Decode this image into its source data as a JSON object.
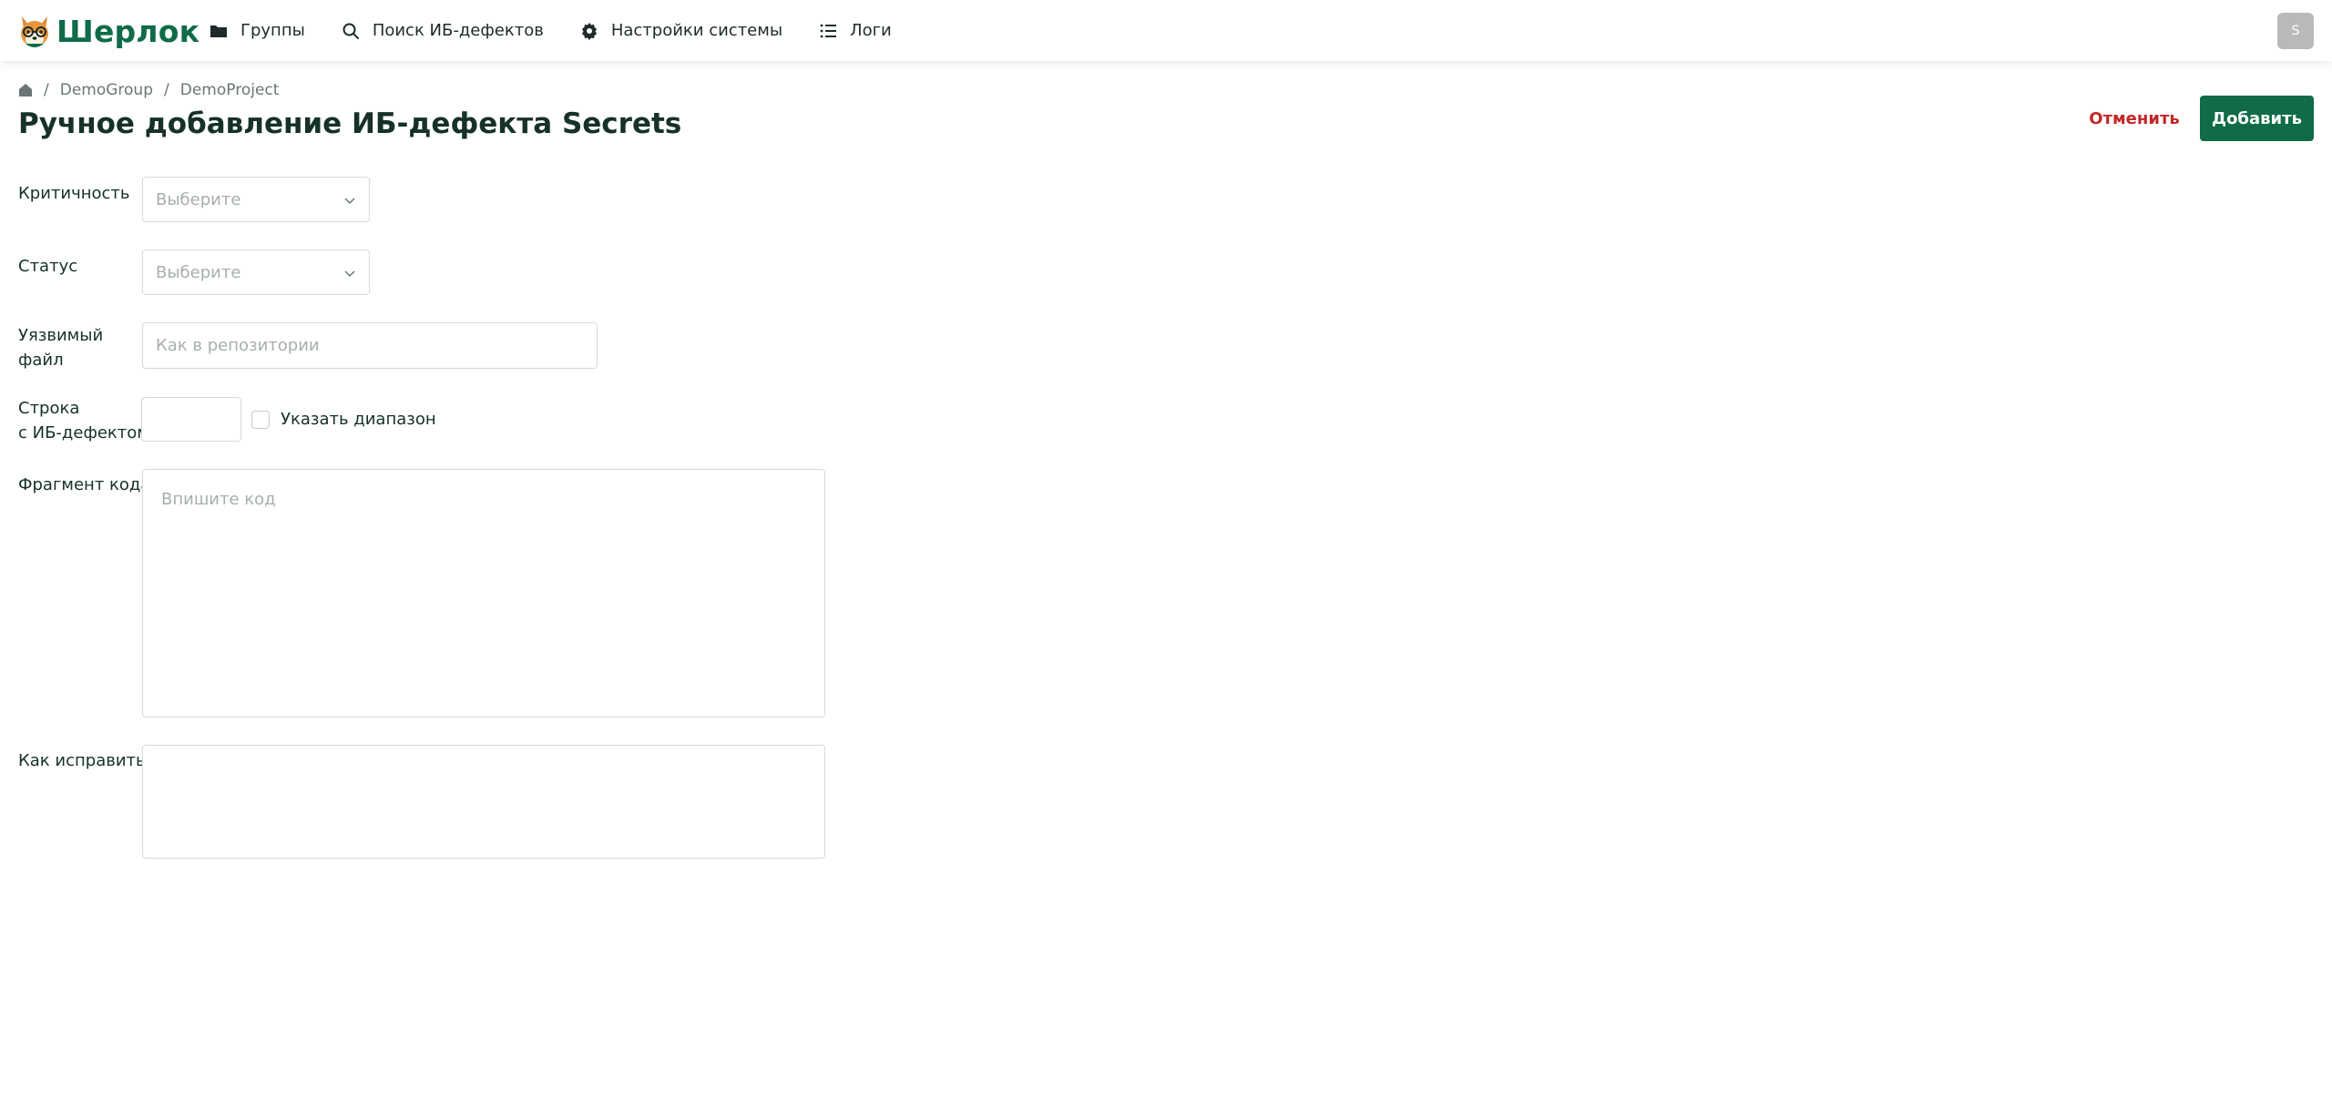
{
  "app": {
    "logo_text": "Шерлок",
    "brand_color": "#0f6b48",
    "danger_color": "#c32727"
  },
  "nav": {
    "items": [
      {
        "label": "Группы",
        "icon": "folder-icon"
      },
      {
        "label": "Поиск ИБ-дефектов",
        "icon": "search-icon"
      },
      {
        "label": "Настройки системы",
        "icon": "gear-icon"
      },
      {
        "label": "Логи",
        "icon": "list-icon"
      }
    ],
    "avatar_initial": "S"
  },
  "breadcrumb": {
    "home_icon": "home-icon",
    "items": [
      "DemoGroup",
      "DemoProject"
    ],
    "separator": "/"
  },
  "page": {
    "title": "Ручное добавление ИБ-дефекта Secrets",
    "cancel_label": "Отменить",
    "add_label": "Добавить"
  },
  "form": {
    "severity": {
      "label": "Критичность",
      "placeholder": "Выберите",
      "value": ""
    },
    "status": {
      "label": "Статус",
      "placeholder": "Выберите",
      "value": ""
    },
    "file": {
      "label_line1": "Уязвимый",
      "label_line2": "файл",
      "placeholder": "Как в репозитории",
      "value": ""
    },
    "line": {
      "label_line1": "Строка",
      "label_line2": "с ИБ-дефектом",
      "value": "",
      "range_label": "Указать диапазон",
      "range_checked": false
    },
    "code": {
      "label": "Фрагмент кода",
      "placeholder": "Впишите код",
      "value": ""
    },
    "fix": {
      "label": "Как исправить",
      "placeholder": "",
      "value": ""
    }
  }
}
